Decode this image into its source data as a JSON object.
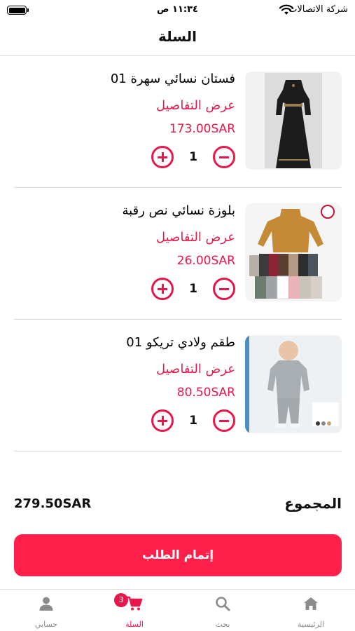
{
  "status_bar": {
    "carrier": "شركة الاتصالات",
    "time": "١١:٣٤ ص"
  },
  "header": {
    "title": "السلة"
  },
  "cart": {
    "items": [
      {
        "name": "فستان نسائي سهرة 01",
        "details_label": "عرض التفاصيل",
        "price": "173.00SAR",
        "quantity": "1",
        "image_icon": "dress-product-image"
      },
      {
        "name": "بلوزة نسائي نص رقبة",
        "details_label": "عرض التفاصيل",
        "price": "26.00SAR",
        "quantity": "1",
        "image_icon": "sweater-product-image"
      },
      {
        "name": "طقم ولادي تريكو 01",
        "details_label": "عرض التفاصيل",
        "price": "80.50SAR",
        "quantity": "1",
        "image_icon": "kids-set-product-image"
      }
    ]
  },
  "summary": {
    "total_label": "المجموع",
    "total_value": "279.50SAR"
  },
  "checkout": {
    "label": "إتمام الطلب"
  },
  "tabbar": {
    "tabs": [
      {
        "label": "الرئيسية",
        "icon": "home-icon"
      },
      {
        "label": "بحث",
        "icon": "search-icon"
      },
      {
        "label": "السلة",
        "icon": "cart-icon",
        "active": true,
        "badge": "3"
      },
      {
        "label": "حسابي",
        "icon": "person-icon"
      }
    ]
  },
  "colors": {
    "accent": "#e8174a",
    "checkout_button": "#ff1f4b",
    "inactive_tab": "#8c8c8c"
  }
}
